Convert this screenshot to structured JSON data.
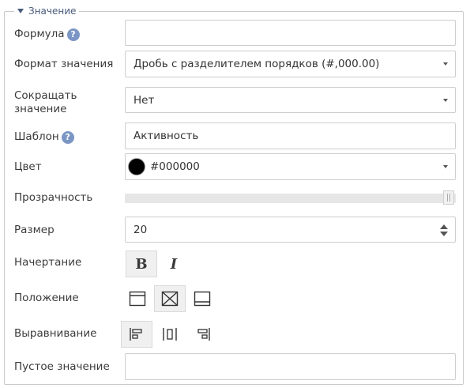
{
  "section": {
    "title": "Значение"
  },
  "fields": {
    "formula": {
      "label": "Формула",
      "value": "",
      "help_icon": "question-circle-icon"
    },
    "format": {
      "label": "Формат значения",
      "value": "Дробь с разделителем порядков (#,000.00)"
    },
    "shorten": {
      "label_line1": "Сокращать",
      "label_line2": "значение",
      "value": "Нет"
    },
    "template": {
      "label": "Шаблон",
      "value": "Активность",
      "help_icon": "question-circle-icon"
    },
    "color": {
      "label": "Цвет",
      "value": "#000000",
      "swatch": "#000000"
    },
    "opacity": {
      "label": "Прозрачность",
      "level": 1.0
    },
    "size": {
      "label": "Размер",
      "value": "20"
    },
    "style": {
      "label": "Начертание",
      "bold_label": "B",
      "italic_label": "I",
      "bold_active": true,
      "italic_active": false
    },
    "position": {
      "label": "Положение",
      "options": [
        "position-top-icon",
        "position-center-icon",
        "position-bottom-icon"
      ],
      "selected": 1
    },
    "alignment": {
      "label": "Выравнивание",
      "options": [
        "align-left-icon",
        "align-center-icon",
        "align-right-icon"
      ],
      "selected": 0
    },
    "empty": {
      "label": "Пустое значение",
      "value": ""
    }
  },
  "colors": {
    "accent": "#7b96c5",
    "border": "#cdcdcd",
    "legend": "#4a5b7a",
    "active_bg": "#f0f0f0"
  }
}
